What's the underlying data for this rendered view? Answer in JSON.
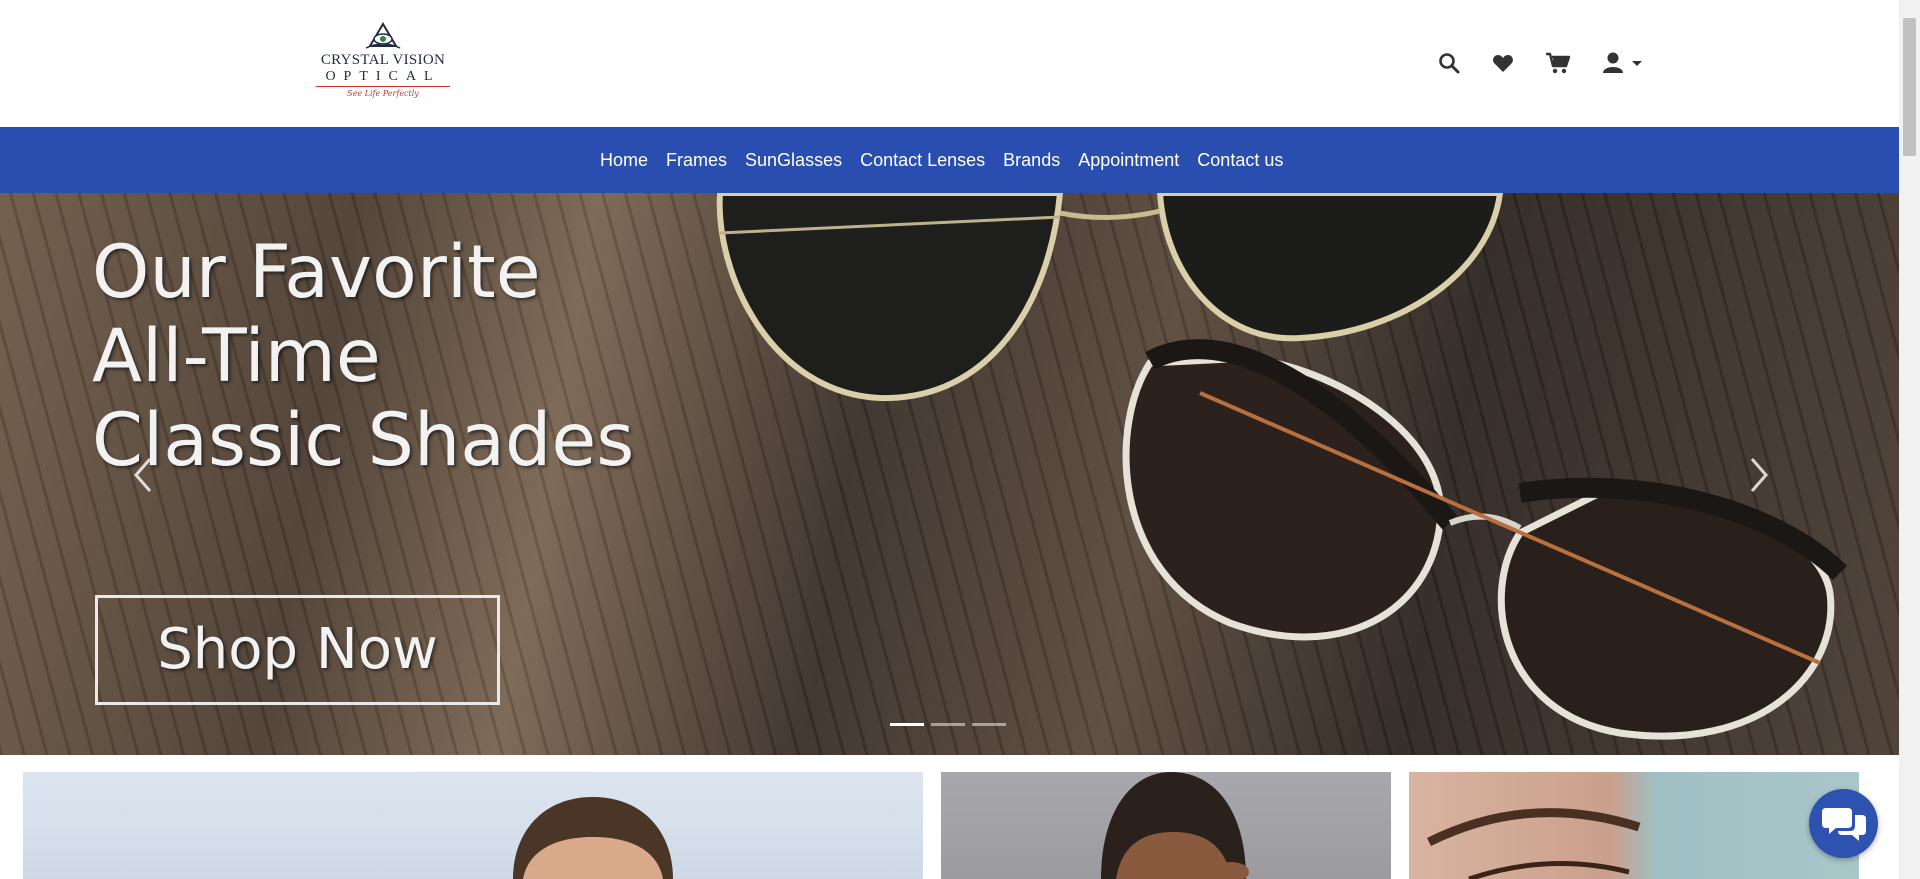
{
  "header": {
    "logo": {
      "line1": "CRYSTAL VISION",
      "line2": "OPTICAL",
      "tagline": "See Life Perfectly"
    },
    "icons": [
      "search-icon",
      "heart-icon",
      "cart-icon",
      "user-icon",
      "caret-down-icon"
    ]
  },
  "nav": {
    "items": [
      {
        "label": "Home"
      },
      {
        "label": "Frames"
      },
      {
        "label": "SunGlasses"
      },
      {
        "label": "Contact Lenses"
      },
      {
        "label": "Brands"
      },
      {
        "label": "Appointment"
      },
      {
        "label": "Contact us"
      }
    ]
  },
  "hero": {
    "headline_lines": [
      "Our Favorite",
      "All-Time",
      "Classic Shades"
    ],
    "cta_label": "Shop Now",
    "slides_total": 3,
    "active_slide": 1
  },
  "promo_tiles": [
    "tile-men",
    "tile-kids",
    "tile-women"
  ],
  "colors": {
    "nav_bg": "#2a4eb0",
    "chat_bg": "#2d52b0",
    "icon": "#333333"
  }
}
